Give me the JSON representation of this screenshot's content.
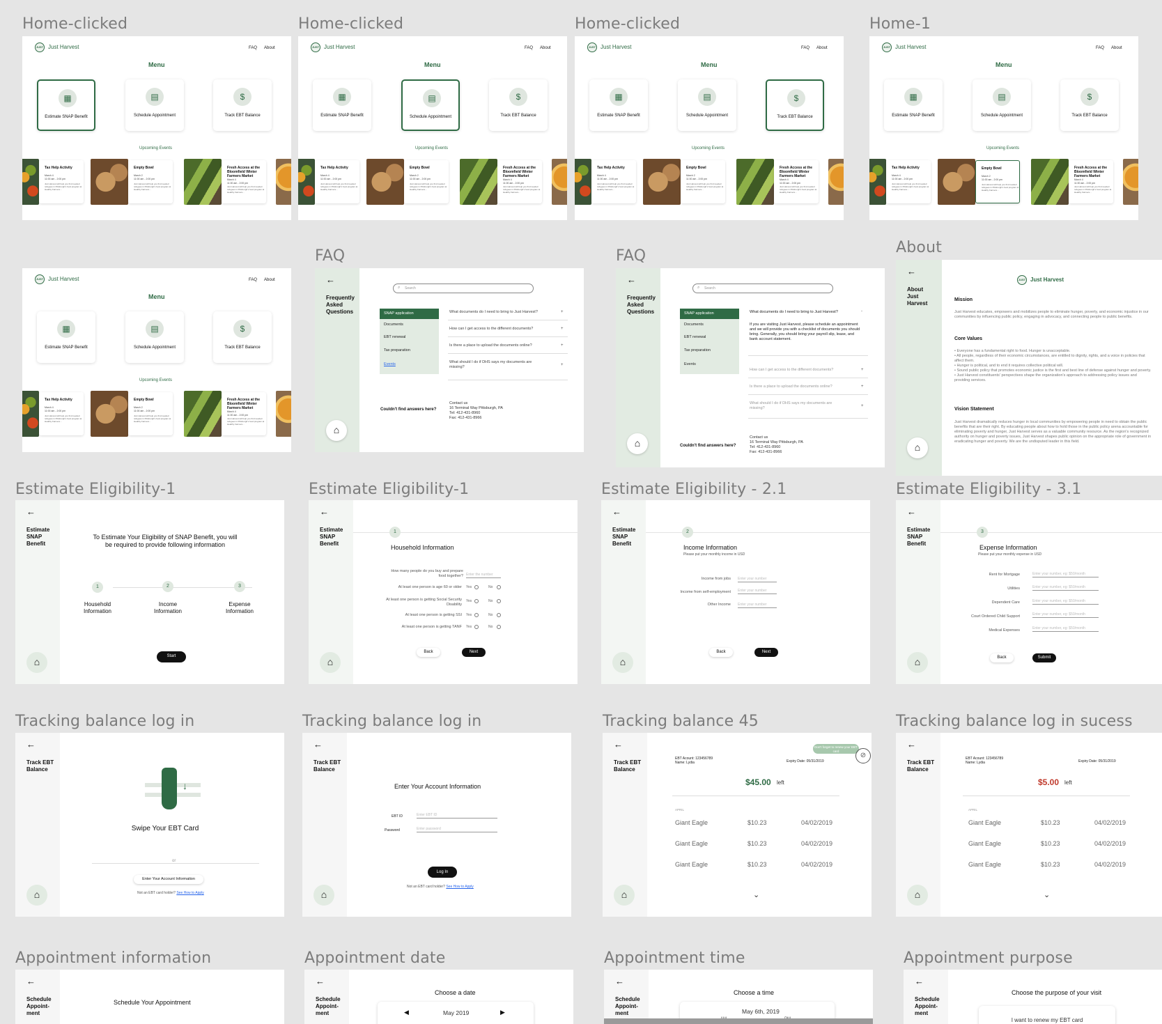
{
  "frames": {
    "home_clicked_1": {
      "label": "Home-clicked"
    },
    "home_clicked_2": {
      "label": "Home-clicked"
    },
    "home_clicked_3": {
      "label": "Home-clicked"
    },
    "home_1": {
      "label": "Home-1"
    },
    "faq_1": {
      "label": "FAQ"
    },
    "faq_2": {
      "label": "FAQ"
    },
    "about": {
      "label": "About"
    },
    "est_1a": {
      "label": "Estimate Eligibility-1"
    },
    "est_1b": {
      "label": "Estimate Eligibility-1"
    },
    "est_21": {
      "label": "Estimate Eligibility - 2.1"
    },
    "est_31": {
      "label": "Estimate Eligibility - 3.1"
    },
    "track_login_1": {
      "label": "Tracking balance log in"
    },
    "track_login_2": {
      "label": "Tracking balance log in"
    },
    "track_45": {
      "label": "Tracking balance 45"
    },
    "track_success": {
      "label": "Tracking balance log in sucess"
    },
    "appt_info": {
      "label": "Appointment information"
    },
    "appt_date": {
      "label": "Appointment date"
    },
    "appt_time": {
      "label": "Appointment time"
    },
    "appt_purpose": {
      "label": "Appointment purpose"
    }
  },
  "home": {
    "logo": "JUST",
    "brand": "Just Harvest",
    "nav_faq": "FAQ",
    "nav_about": "About",
    "menu": "Menu",
    "card_estimate": "Estimate SNAP Benefit",
    "card_schedule": "Schedule Appointment",
    "card_track": "Track EBT Balance",
    "upcoming": "Upcoming Events",
    "ev1_title": "Tax Help Activity",
    "ev1_time": "March 4\n11:00 am - 2:00 pm",
    "ev2_title": "Empty Bowl",
    "ev2_time": "March 2\n11:00 am - 2:00 pm",
    "ev3_title": "Fresh Access at the Bloomfield Winter Farmers Market",
    "ev3_time": "March 4\n11:00 am - 2:00 pm",
    "ev_desc": "Just Harvest will help you find needed refugees in Pittsburgh's food program at Healthy Farmers..."
  },
  "faq": {
    "title": "Frequently Asked Questions",
    "search": "Search",
    "nav": [
      "SNAP application",
      "Documents",
      "EBT renewal",
      "Tax preparation",
      "Events"
    ],
    "q1": "What documents do I need to bring to Just Harvest?",
    "q2": "How can I get access to the different documents?",
    "q3": "Is there a place to upload the documents online?",
    "q4": "What should I do if DHS says my documents are missing?",
    "a1": "If you are visiting Just Harvest, please schedule an appointment and we will provide you with a checklist of documents you should bring. Generally, you should bring your payroll slip, lease, and bank account statement.",
    "no_answer": "Couldn't find answers here?",
    "contact_title": "Contact us",
    "contact_addr": "16 Terminal Way Pittsburgh, PA",
    "contact_tel": "Tel: 412-431-8960",
    "contact_fax": "Fax: 412-431-8966"
  },
  "about": {
    "side_title": "About Just Harvest",
    "mission_h": "Mission",
    "mission": "Just Harvest educates, empowers and mobilizes people to eliminate hunger, poverty, and economic injustice in our communities by influencing public policy, engaging in advocacy, and connecting people to public benefits.",
    "core_h": "Core Values",
    "core": [
      "• Everyone has a fundamental right to food. Hunger is unacceptable.",
      "• All people, regardless of their economic circumstances, are entitled to dignity, rights, and a voice in policies that affect them.",
      "• Hunger is political, and to end it requires collective political will.",
      "• Sound public policy that promotes economic justice is the first and best line of defense against hunger and poverty.",
      "• Just Harvest constituents' perspectives shape the organization's approach to addressing policy issues and providing services."
    ],
    "vision_h": "Vision Statement",
    "vision": "Just Harvest dramatically reduces hunger in local communities by empowering people in need to obtain the public benefits that are their right. By educating people about how to hold those in the public policy arena accountable for eliminating poverty and hunger, Just Harvest serves as a valuable community resource. As the region's recognized authority on hunger and poverty issues, Just Harvest shapes public opinion on the appropriate role of government in eradicating hunger and poverty. We are the undisputed leader in this field."
  },
  "estimate": {
    "side": "Estimate SNAP Benefit",
    "intro": "To Estimate Your Eligibility of SNAP Benefit, you will be required to provide following information",
    "s1": "Household Information",
    "s2": "Income Information",
    "s3": "Expense Information",
    "start": "Start",
    "household_h": "Household Information",
    "q_people": "How many people do you buy and prepare food together?",
    "q_age60": "At least one person is age 60 or older",
    "q_ssd": "At least one person is getting Social Security Disability",
    "q_ssi": "At least one person is getting SSI",
    "q_tanf": "At least one person is getting TANF",
    "enter_number": "Enter the number",
    "yes": "Yes",
    "no": "No",
    "back": "Back",
    "next": "Next",
    "submit": "Submit",
    "income_h": "Income Information",
    "income_sub": "Please put your monthly income in USD",
    "inc_jobs": "Income from jobs",
    "inc_self": "Income from self-employment",
    "inc_other": "Other Income",
    "enter_your_number": "Enter your number",
    "expense_h": "Expense Information",
    "expense_sub": "Please put your monthly expense in USD",
    "exp_rent": "Rent for Mortgage",
    "exp_util": "Utilities",
    "exp_dep": "Dependent Care",
    "exp_child": "Court Ordered Child Support",
    "exp_med": "Medical Expenses",
    "exp_ph": "Enter your number, eg: $50/month",
    "n1": "1",
    "n2": "2",
    "n3": "3"
  },
  "track": {
    "side": "Track EBT Balance",
    "swipe": "Swipe Your EBT Card",
    "or": "or",
    "enter_acct_btn": "Enter Your Account Information",
    "not_holder": "Not an EBT card holder?",
    "how_apply": "See How to Apply",
    "enter_acct_h": "Enter Your Account Information",
    "ebt_id": "EBT ID",
    "password": "Password",
    "ph_id": "Enter EBT ID",
    "ph_pw": "Enter password",
    "login": "Log In",
    "account": "EBT Acount: 123456789",
    "name": "Name:  Lydia",
    "expiry": "Expiry Date: 05/31/2019",
    "balance45": "$45.00",
    "balance5": "$5.00",
    "left": "left",
    "month": "APRIL",
    "tx_store": "Giant Eagle",
    "tx_amount": "$10.23",
    "tx_date": "04/02/2019",
    "reminder": "Don't forget to renew your EBT card"
  },
  "appt": {
    "side": "Schedule Appoint-ment",
    "info_h": "Schedule Your Appointment",
    "date_h": "Choose a date",
    "month": "May 2019",
    "time_h": "Choose a time",
    "time_date": "May 6th, 2019",
    "am": "AM",
    "pm": "PM",
    "purpose_h": "Choose the purpose of your visit",
    "purpose1": "I want to renew my EBT card"
  },
  "colors": {
    "brand_green": "#2f6b45",
    "side_bg": "#e2ebe2",
    "balance_green": "#2f6b45",
    "balance_red": "#c0392b"
  }
}
